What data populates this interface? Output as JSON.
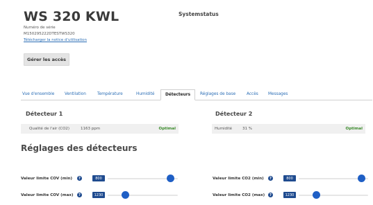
{
  "device": {
    "title": "WS 320 KWL",
    "serial_label": "Numéro de série",
    "serial_value": "M150295222DTESTWS320",
    "manual_link": "Télécharger la notice d'utilisation",
    "access_button": "Gérer les accès"
  },
  "system_status": "Systemstatus",
  "tabs": [
    {
      "label": "Vue d'ensemble",
      "active": false
    },
    {
      "label": "Ventilation",
      "active": false
    },
    {
      "label": "Température",
      "active": false
    },
    {
      "label": "Humidité",
      "active": false
    },
    {
      "label": "Détecteurs",
      "active": true
    },
    {
      "label": "Réglages de base",
      "active": false
    },
    {
      "label": "Accès",
      "active": false
    },
    {
      "label": "Messages",
      "active": false
    }
  ],
  "detectors": [
    {
      "title": "Détecteur 1",
      "name": "Qualité de l'air (CO2)",
      "value": "1163 ppm",
      "status": "Optimal"
    },
    {
      "title": "Détecteur 2",
      "name": "Humidité",
      "value": "31 %",
      "status": "Optimal"
    }
  ],
  "settings_title": "Réglages des détecteurs",
  "help_glyph": "?",
  "settings": [
    {
      "label": "Valeur limite COV (min)",
      "value": "800",
      "level": 0.9
    },
    {
      "label": "Valeur limite CO2 (min)",
      "value": "800",
      "level": 0.9
    },
    {
      "label": "Valeur limite COV (max)",
      "value": "1230",
      "level": 0.25
    },
    {
      "label": "Valeur limite CO2 (max)",
      "value": "1230",
      "level": 0.25
    }
  ],
  "colors": {
    "accent": "#1f4b8f",
    "slider": "#1f5fc5",
    "link": "#2a6db5",
    "status_ok": "#3a8a2a"
  }
}
